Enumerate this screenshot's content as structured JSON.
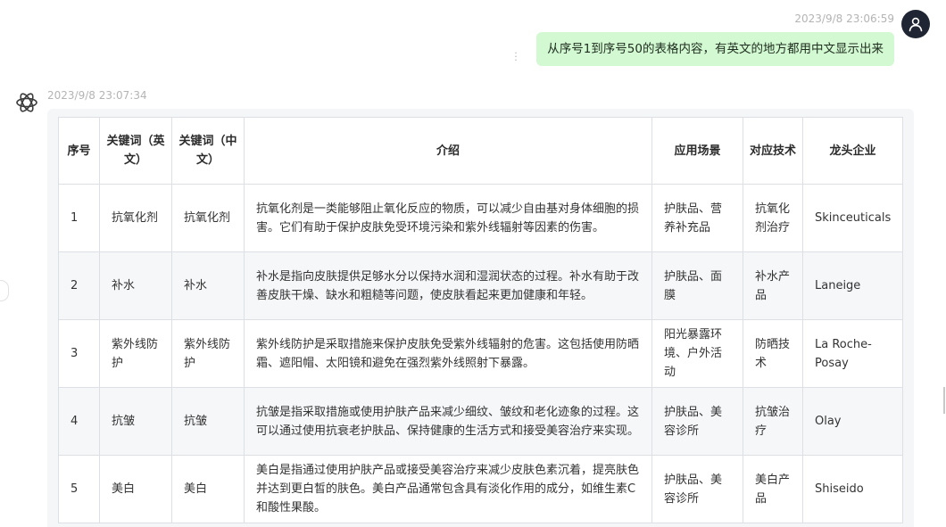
{
  "user_message": {
    "timestamp": "2023/9/8 23:06:59",
    "text": "从序号1到序号50的表格内容，有英文的地方都用中文显示出来"
  },
  "bot_message": {
    "timestamp": "2023/9/8 23:07:34"
  },
  "table": {
    "headers": {
      "no": "序号",
      "kw_en": "关键词（英文）",
      "kw_cn": "关键词（中文）",
      "intro": "介绍",
      "scene": "应用场景",
      "tech": "对应技术",
      "company": "龙头企业"
    },
    "rows": [
      {
        "no": "1",
        "kw_en": "抗氧化剂",
        "kw_cn": "抗氧化剂",
        "intro": "抗氧化剂是一类能够阻止氧化反应的物质，可以减少自由基对身体细胞的损害。它们有助于保护皮肤免受环境污染和紫外线辐射等因素的伤害。",
        "scene": "护肤品、营养补充品",
        "tech": "抗氧化剂治疗",
        "company": "Skinceuticals"
      },
      {
        "no": "2",
        "kw_en": "补水",
        "kw_cn": "补水",
        "intro": "补水是指向皮肤提供足够水分以保持水润和湿润状态的过程。补水有助于改善皮肤干燥、缺水和粗糙等问题，使皮肤看起来更加健康和年轻。",
        "scene": "护肤品、面膜",
        "tech": "补水产品",
        "company": "Laneige"
      },
      {
        "no": "3",
        "kw_en": "紫外线防护",
        "kw_cn": "紫外线防护",
        "intro": "紫外线防护是采取措施来保护皮肤免受紫外线辐射的危害。这包括使用防晒霜、遮阳帽、太阳镜和避免在强烈紫外线照射下暴露。",
        "scene": "阳光暴露环境、户外活动",
        "tech": "防晒技术",
        "company": "La Roche-Posay"
      },
      {
        "no": "4",
        "kw_en": "抗皱",
        "kw_cn": "抗皱",
        "intro": "抗皱是指采取措施或使用护肤产品来减少细纹、皱纹和老化迹象的过程。这可以通过使用抗衰老护肤品、保持健康的生活方式和接受美容治疗来实现。",
        "scene": "护肤品、美容诊所",
        "tech": "抗皱治疗",
        "company": "Olay"
      },
      {
        "no": "5",
        "kw_en": "美白",
        "kw_cn": "美白",
        "intro": "美白是指通过使用护肤产品或接受美容治疗来减少皮肤色素沉着，提亮肤色并达到更白皙的肤色。美白产品通常包含具有淡化作用的成分，如维生素C和酸性果酸。",
        "scene": "护肤品、美容诊所",
        "tech": "美白产品",
        "company": "Shiseido"
      }
    ]
  }
}
